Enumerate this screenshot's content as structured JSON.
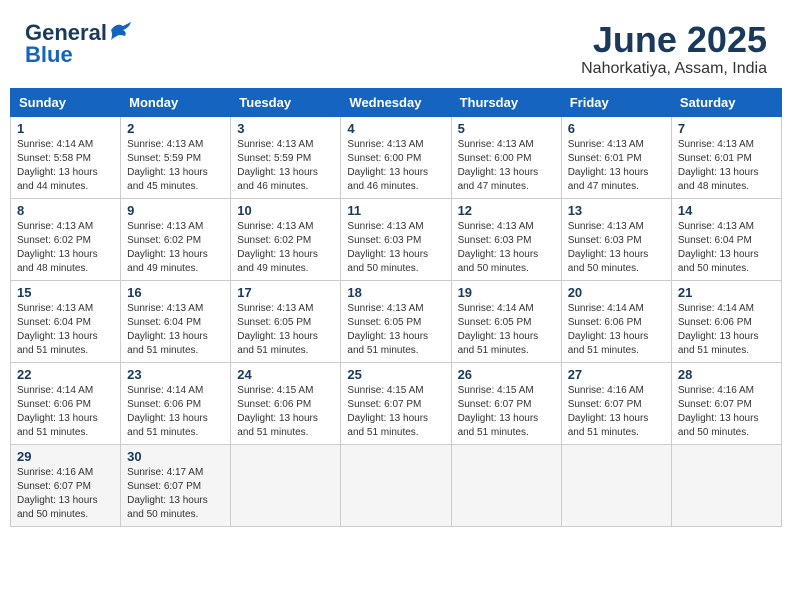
{
  "header": {
    "logo_line1": "General",
    "logo_line2": "Blue",
    "month": "June 2025",
    "location": "Nahorkatiya, Assam, India"
  },
  "weekdays": [
    "Sunday",
    "Monday",
    "Tuesday",
    "Wednesday",
    "Thursday",
    "Friday",
    "Saturday"
  ],
  "weeks": [
    [
      {
        "day": "1",
        "info": "Sunrise: 4:14 AM\nSunset: 5:58 PM\nDaylight: 13 hours\nand 44 minutes."
      },
      {
        "day": "2",
        "info": "Sunrise: 4:13 AM\nSunset: 5:59 PM\nDaylight: 13 hours\nand 45 minutes."
      },
      {
        "day": "3",
        "info": "Sunrise: 4:13 AM\nSunset: 5:59 PM\nDaylight: 13 hours\nand 46 minutes."
      },
      {
        "day": "4",
        "info": "Sunrise: 4:13 AM\nSunset: 6:00 PM\nDaylight: 13 hours\nand 46 minutes."
      },
      {
        "day": "5",
        "info": "Sunrise: 4:13 AM\nSunset: 6:00 PM\nDaylight: 13 hours\nand 47 minutes."
      },
      {
        "day": "6",
        "info": "Sunrise: 4:13 AM\nSunset: 6:01 PM\nDaylight: 13 hours\nand 47 minutes."
      },
      {
        "day": "7",
        "info": "Sunrise: 4:13 AM\nSunset: 6:01 PM\nDaylight: 13 hours\nand 48 minutes."
      }
    ],
    [
      {
        "day": "8",
        "info": "Sunrise: 4:13 AM\nSunset: 6:02 PM\nDaylight: 13 hours\nand 48 minutes."
      },
      {
        "day": "9",
        "info": "Sunrise: 4:13 AM\nSunset: 6:02 PM\nDaylight: 13 hours\nand 49 minutes."
      },
      {
        "day": "10",
        "info": "Sunrise: 4:13 AM\nSunset: 6:02 PM\nDaylight: 13 hours\nand 49 minutes."
      },
      {
        "day": "11",
        "info": "Sunrise: 4:13 AM\nSunset: 6:03 PM\nDaylight: 13 hours\nand 50 minutes."
      },
      {
        "day": "12",
        "info": "Sunrise: 4:13 AM\nSunset: 6:03 PM\nDaylight: 13 hours\nand 50 minutes."
      },
      {
        "day": "13",
        "info": "Sunrise: 4:13 AM\nSunset: 6:03 PM\nDaylight: 13 hours\nand 50 minutes."
      },
      {
        "day": "14",
        "info": "Sunrise: 4:13 AM\nSunset: 6:04 PM\nDaylight: 13 hours\nand 50 minutes."
      }
    ],
    [
      {
        "day": "15",
        "info": "Sunrise: 4:13 AM\nSunset: 6:04 PM\nDaylight: 13 hours\nand 51 minutes."
      },
      {
        "day": "16",
        "info": "Sunrise: 4:13 AM\nSunset: 6:04 PM\nDaylight: 13 hours\nand 51 minutes."
      },
      {
        "day": "17",
        "info": "Sunrise: 4:13 AM\nSunset: 6:05 PM\nDaylight: 13 hours\nand 51 minutes."
      },
      {
        "day": "18",
        "info": "Sunrise: 4:13 AM\nSunset: 6:05 PM\nDaylight: 13 hours\nand 51 minutes."
      },
      {
        "day": "19",
        "info": "Sunrise: 4:14 AM\nSunset: 6:05 PM\nDaylight: 13 hours\nand 51 minutes."
      },
      {
        "day": "20",
        "info": "Sunrise: 4:14 AM\nSunset: 6:06 PM\nDaylight: 13 hours\nand 51 minutes."
      },
      {
        "day": "21",
        "info": "Sunrise: 4:14 AM\nSunset: 6:06 PM\nDaylight: 13 hours\nand 51 minutes."
      }
    ],
    [
      {
        "day": "22",
        "info": "Sunrise: 4:14 AM\nSunset: 6:06 PM\nDaylight: 13 hours\nand 51 minutes."
      },
      {
        "day": "23",
        "info": "Sunrise: 4:14 AM\nSunset: 6:06 PM\nDaylight: 13 hours\nand 51 minutes."
      },
      {
        "day": "24",
        "info": "Sunrise: 4:15 AM\nSunset: 6:06 PM\nDaylight: 13 hours\nand 51 minutes."
      },
      {
        "day": "25",
        "info": "Sunrise: 4:15 AM\nSunset: 6:07 PM\nDaylight: 13 hours\nand 51 minutes."
      },
      {
        "day": "26",
        "info": "Sunrise: 4:15 AM\nSunset: 6:07 PM\nDaylight: 13 hours\nand 51 minutes."
      },
      {
        "day": "27",
        "info": "Sunrise: 4:16 AM\nSunset: 6:07 PM\nDaylight: 13 hours\nand 51 minutes."
      },
      {
        "day": "28",
        "info": "Sunrise: 4:16 AM\nSunset: 6:07 PM\nDaylight: 13 hours\nand 50 minutes."
      }
    ],
    [
      {
        "day": "29",
        "info": "Sunrise: 4:16 AM\nSunset: 6:07 PM\nDaylight: 13 hours\nand 50 minutes."
      },
      {
        "day": "30",
        "info": "Sunrise: 4:17 AM\nSunset: 6:07 PM\nDaylight: 13 hours\nand 50 minutes."
      },
      {
        "day": "",
        "info": ""
      },
      {
        "day": "",
        "info": ""
      },
      {
        "day": "",
        "info": ""
      },
      {
        "day": "",
        "info": ""
      },
      {
        "day": "",
        "info": ""
      }
    ]
  ]
}
